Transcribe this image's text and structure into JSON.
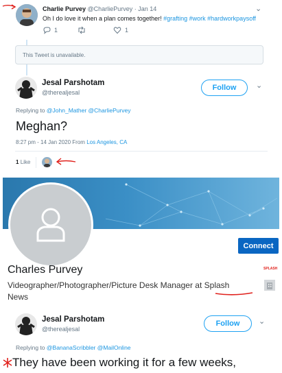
{
  "tweet1": {
    "name": "Charlie Purvey",
    "handle_date": "@CharliePurvey · Jan 14",
    "text": "Oh I do love it when a plan comes together!",
    "hashtags": "#grafting #work #hardworkpaysoff",
    "reply_count": "1",
    "like_count": "1"
  },
  "unavailable": "This Tweet is unavailable.",
  "tweet2": {
    "name": "Jesal Parshotam",
    "handle": "@therealjesal",
    "follow_label": "Follow",
    "replying_prefix": "Replying to",
    "replying_to": "@John_Mather @CharliePurvey",
    "text": "Meghan?",
    "meta": "8:27 pm - 14 Jan 2020 From",
    "location": "Los Angeles, CA",
    "likes_count": "1",
    "likes_label": "Like"
  },
  "linkedin": {
    "name": "Charles Purvey",
    "headline_part1": "Videographer/Photographer/Picture Desk Manager at",
    "headline_highlight": "Splash",
    "headline_part2": "News",
    "connect_label": "Connect",
    "brand_logo_text": "SPLASH"
  },
  "tweet3": {
    "name": "Jesal Parshotam",
    "handle": "@therealjesal",
    "follow_label": "Follow",
    "replying_prefix": "Replying to",
    "replying_to": "@BananaScribbler @MailOnline",
    "text": "They have been working it for a few weeks,"
  },
  "colors": {
    "twitter_blue": "#1da1f2",
    "linkedin_blue": "#0a66c2",
    "annotation_red": "#e0201b"
  }
}
